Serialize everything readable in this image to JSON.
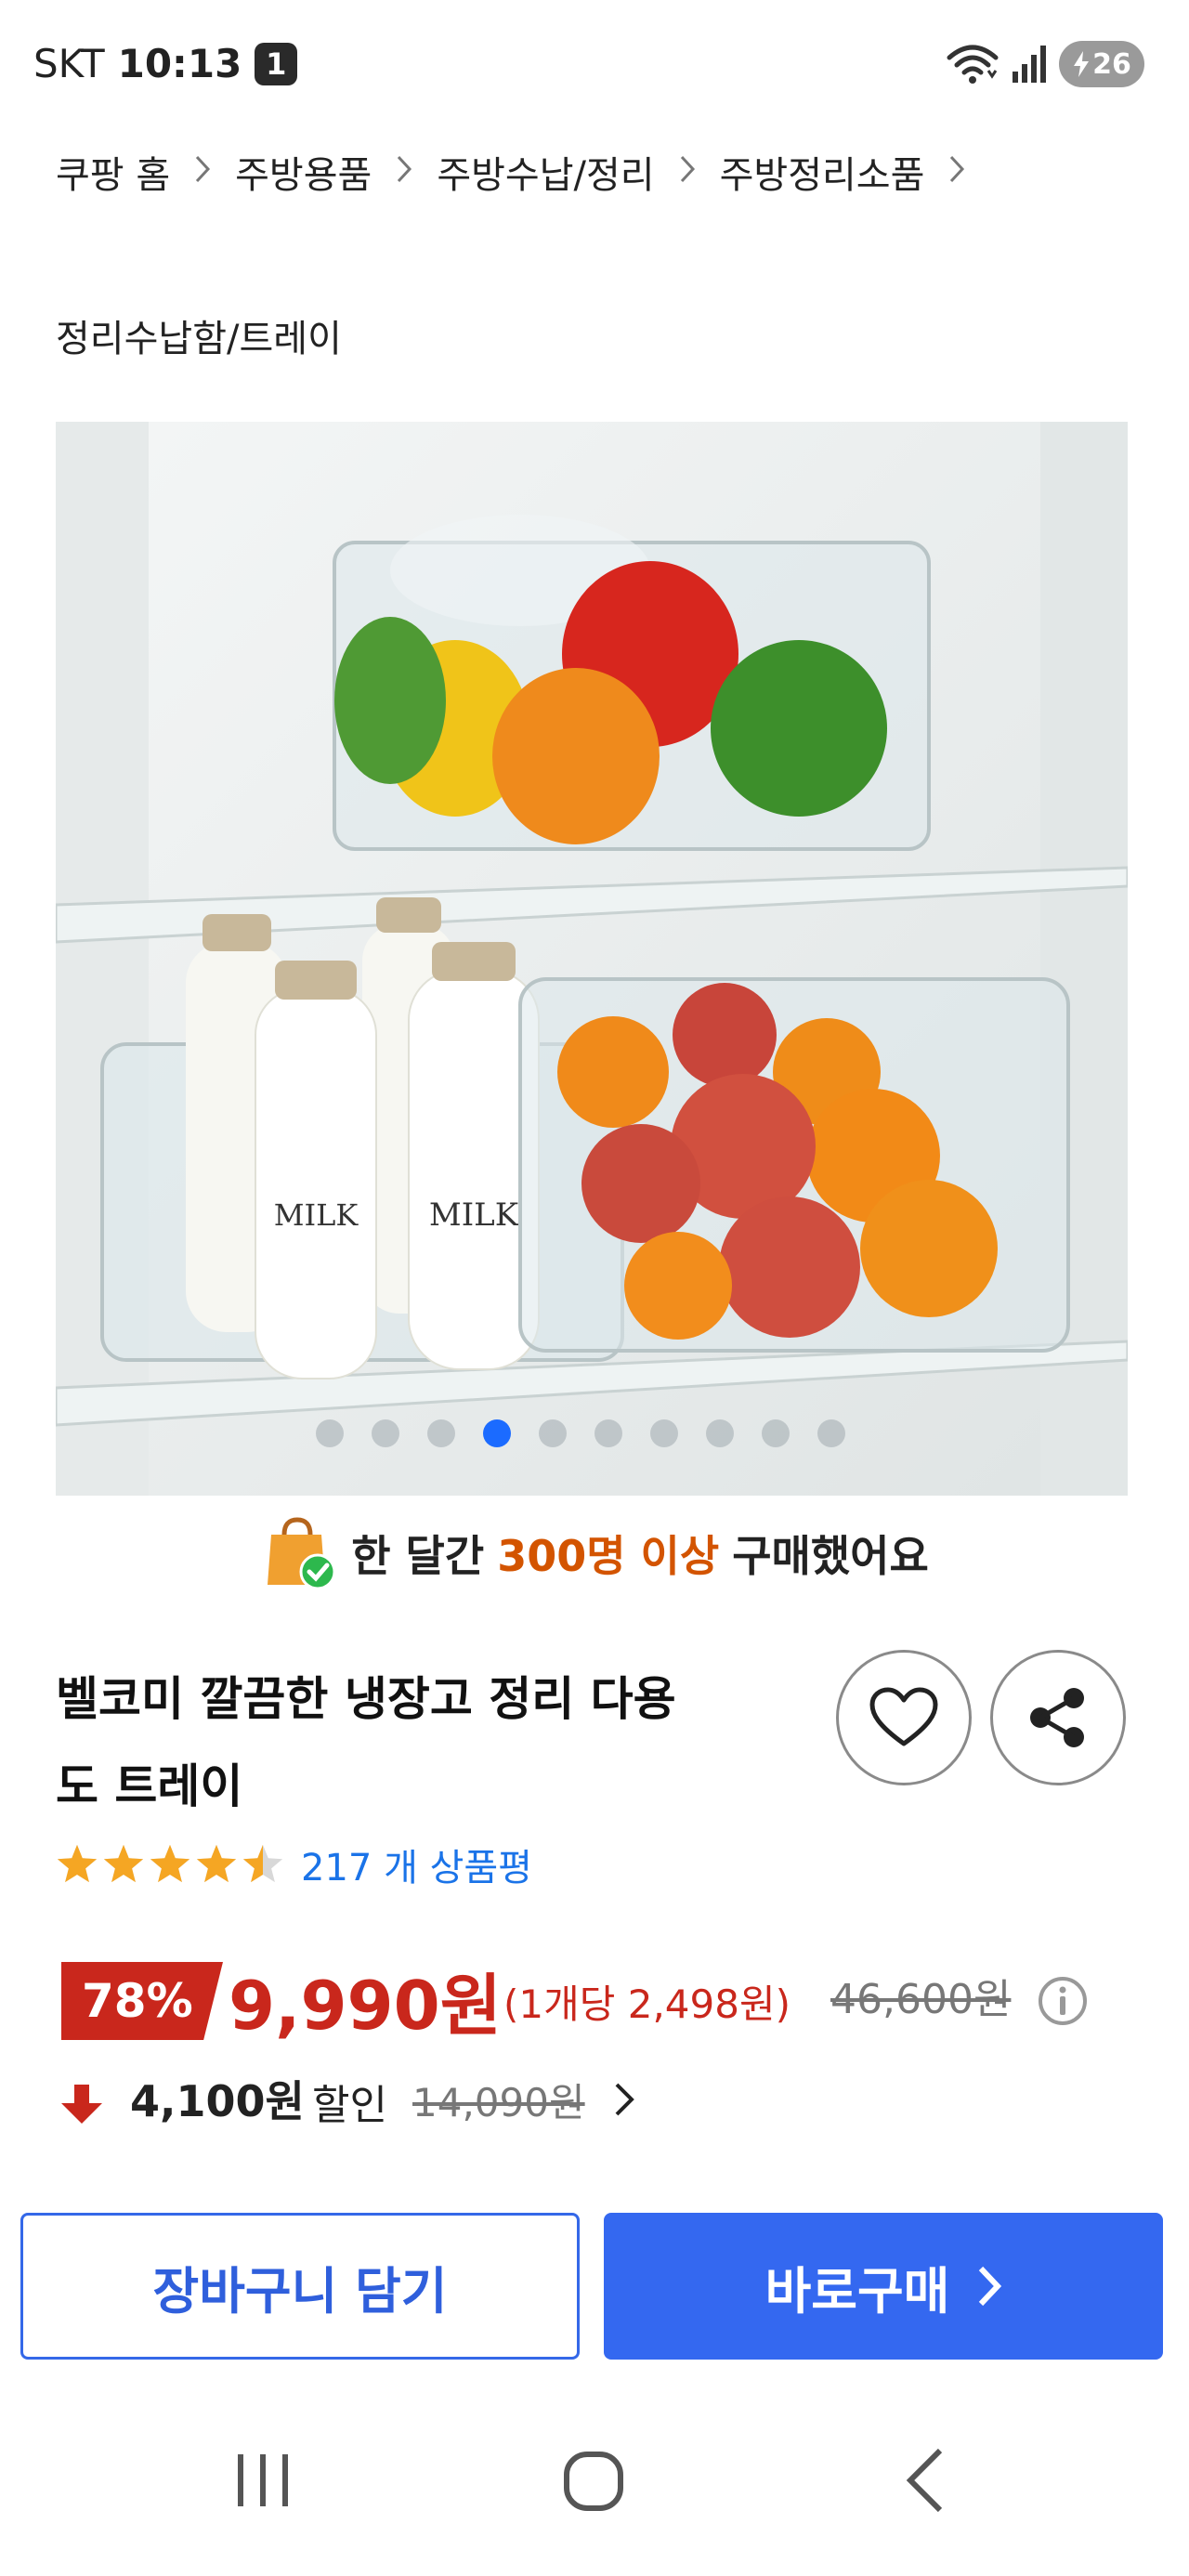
{
  "status_bar": {
    "carrier": "SKT",
    "time": "10:13",
    "notification_count": "1",
    "battery": "26",
    "icons": [
      "wifi-icon",
      "signal-icon",
      "battery-charging-icon"
    ]
  },
  "breadcrumb": {
    "items": [
      "쿠팡 홈",
      "주방용품",
      "주방수납/정리",
      "주방정리소품"
    ],
    "separator": ">"
  },
  "subcategory": "정리수납함/트레이",
  "gallery": {
    "dot_count": 10,
    "active_index": 3
  },
  "social_proof": {
    "prefix": "한 달간",
    "highlight": "300명 이상",
    "suffix": "구매했어요"
  },
  "product": {
    "title_line1": "벨코미 깔끔한 냉장고 정리 다용",
    "title_line2": "도 트레이",
    "rating": 4.5,
    "review_count": "217 개 상품평"
  },
  "price": {
    "discount_rate": "78%",
    "sale_price": "9,990원",
    "unit_price": "(1개당 2,498원)",
    "original_price": "46,600원"
  },
  "coupon": {
    "discount_amount": "4,100원",
    "label": "할인",
    "original": "14,090원"
  },
  "buttons": {
    "cart": "장바구니 담기",
    "buy": "바로구매"
  },
  "colors": {
    "accent_blue": "#3468f0",
    "price_red": "#c9271c",
    "highlight_orange": "#d35400",
    "star_orange": "#f5a623"
  }
}
